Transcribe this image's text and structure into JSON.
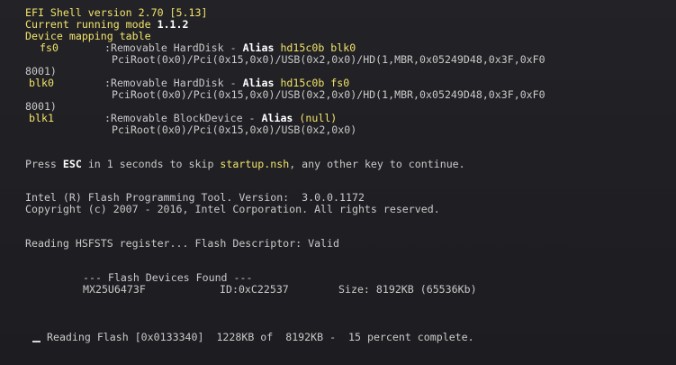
{
  "shell": {
    "title": "EFI Shell version 2.70 [5.13]",
    "mode_prefix": "Current running mode ",
    "mode_value": "1.1.2",
    "mapping_header": "Device mapping table"
  },
  "mappings": [
    {
      "name": "fs0",
      "desc": ":Removable HardDisk - ",
      "alias_label": "Alias",
      "alias_value": "hd15c0b blk0",
      "path": "PciRoot(0x0)/Pci(0x15,0x0)/USB(0x2,0x0)/HD(1,MBR,0x05249D48,0x3F,0xF0",
      "path_cont": "8001)"
    },
    {
      "name": "blk0",
      "desc": ":Removable HardDisk - ",
      "alias_label": "Alias",
      "alias_value": "hd15c0b fs0",
      "path": "PciRoot(0x0)/Pci(0x15,0x0)/USB(0x2,0x0)/HD(1,MBR,0x05249D48,0x3F,0xF0",
      "path_cont": "8001)"
    },
    {
      "name": "blk1",
      "desc": ":Removable BlockDevice - ",
      "alias_label": "Alias",
      "alias_value": "(null)",
      "path": "PciRoot(0x0)/Pci(0x15,0x0)/USB(0x2,0x0)",
      "path_cont": ""
    }
  ],
  "startup": {
    "prefix": "Press ",
    "key": "ESC",
    "middle": " in 1 seconds to skip ",
    "script": "startup.nsh",
    "suffix": ", any other key to continue."
  },
  "fpt": {
    "version_line": "Intel (R) Flash Programming Tool. Version:  3.0.0.1172",
    "copyright_line": "Copyright (c) 2007 - 2016, Intel Corporation. All rights reserved.",
    "hsfsts_line": "Reading HSFSTS register... Flash Descriptor: Valid",
    "devices_header": "--- Flash Devices Found ---",
    "device": {
      "part": "MX25U6473F",
      "id": "ID:0xC22537",
      "size": "Size: 8192KB (65536Kb)"
    },
    "progress_line": "Reading Flash [0x0133340]  1228KB of  8192KB -  15 percent complete."
  }
}
